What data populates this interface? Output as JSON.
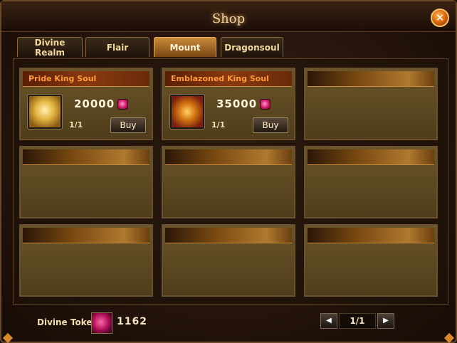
{
  "window": {
    "title": "Shop",
    "close_label": "✕"
  },
  "tabs": [
    {
      "line1": "Divine",
      "line2": "Realm",
      "active": false
    },
    {
      "label": "Flair",
      "active": false
    },
    {
      "label": "Mount",
      "active": true
    },
    {
      "label": "Dragonsoul",
      "active": false
    }
  ],
  "items": [
    {
      "name": "Pride King Soul",
      "price": "20000",
      "count": "1/1",
      "buy_label": "Buy",
      "icon": "lion-icon"
    },
    {
      "name": "Emblazoned King Soul",
      "price": "35000",
      "count": "1/1",
      "buy_label": "Buy",
      "icon": "dragon-icon"
    }
  ],
  "footer": {
    "token_label": "Divine Token",
    "token_value": "1162",
    "page": "1/1",
    "prev_label": "◀",
    "next_label": "▶"
  },
  "colors": {
    "accent": "#ff9a3a",
    "gold": "#c98a3a",
    "gem": "#d0186a"
  }
}
